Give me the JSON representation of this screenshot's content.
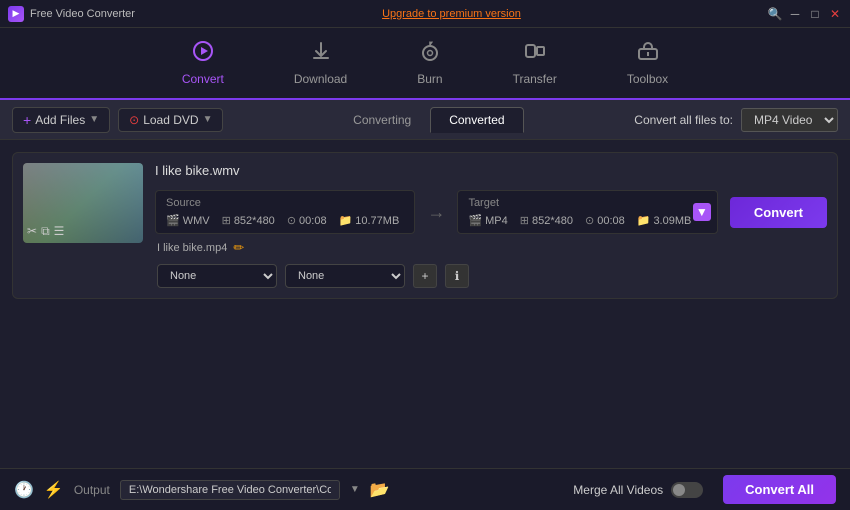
{
  "titleBar": {
    "appName": "Free Video Converter",
    "upgradeText": "Upgrade to premium version",
    "searchIcon": "🔍",
    "minimizeIcon": "─",
    "maximizeIcon": "□",
    "closeIcon": "✕"
  },
  "nav": {
    "items": [
      {
        "id": "convert",
        "label": "Convert",
        "icon": "⟳",
        "active": true
      },
      {
        "id": "download",
        "label": "Download",
        "icon": "⬇",
        "active": false
      },
      {
        "id": "burn",
        "label": "Burn",
        "icon": "⊙",
        "active": false
      },
      {
        "id": "transfer",
        "label": "Transfer",
        "icon": "⇄",
        "active": false
      },
      {
        "id": "toolbox",
        "label": "Toolbox",
        "icon": "⊞",
        "active": false
      }
    ]
  },
  "toolbar": {
    "addFilesLabel": "Add Files",
    "loadDvdLabel": "Load DVD",
    "tabs": [
      {
        "id": "converting",
        "label": "Converting",
        "active": false
      },
      {
        "id": "converted",
        "label": "Converted",
        "active": true
      }
    ],
    "convertAllLabel": "Convert all files to:",
    "formatOption": "MP4 Video"
  },
  "fileList": [
    {
      "id": "file1",
      "sourceName": "I like bike.wmv",
      "targetName": "I like bike.mp4",
      "source": {
        "label": "Source",
        "format": "WMV",
        "resolution": "852*480",
        "duration": "00:08",
        "size": "10.77MB"
      },
      "target": {
        "label": "Target",
        "format": "MP4",
        "resolution": "852*480",
        "duration": "00:08",
        "size": "3.09MB"
      },
      "dropdowns": {
        "effectLeft": "None",
        "effectRight": "None"
      }
    }
  ],
  "convertButton": "Convert",
  "bottomBar": {
    "outputLabel": "Output",
    "outputPath": "E:\\Wondershare Free Video Converter\\Converted",
    "mergeLabel": "Merge All Videos",
    "convertAllBtn": "Convert All"
  }
}
